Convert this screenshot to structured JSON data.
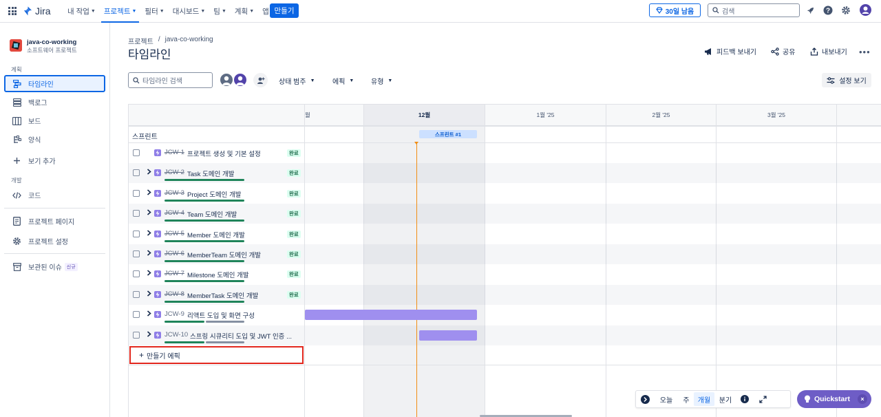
{
  "topnav": {
    "logo": "Jira",
    "items": [
      {
        "label": "내 작업",
        "active": false
      },
      {
        "label": "프로젝트",
        "active": true
      },
      {
        "label": "필터",
        "active": false
      },
      {
        "label": "대시보드",
        "active": false
      },
      {
        "label": "팀",
        "active": false
      },
      {
        "label": "계획",
        "active": false
      },
      {
        "label": "앱",
        "active": false
      }
    ],
    "create_label": "만들기",
    "trial_label": "30일 남음",
    "search_placeholder": "검색"
  },
  "sidebar": {
    "project_name": "java-co-working",
    "project_type": "소프트웨어 프로젝트",
    "section_planning": "계획",
    "section_dev": "개발",
    "items": {
      "timeline": "타임라인",
      "backlog": "백로그",
      "board": "보드",
      "forms": "양식",
      "add_view": "보기 추가",
      "code": "코드",
      "project_pages": "프로젝트 페이지",
      "project_settings": "프로젝트 설정",
      "archived": "보관된 이슈",
      "archived_badge": "신규"
    }
  },
  "header": {
    "breadcrumb_root": "프로젝트",
    "breadcrumb_sep": "/",
    "breadcrumb_project": "java-co-working",
    "title": "타임라인",
    "feedback": "피드백 보내기",
    "share": "공유",
    "export": "내보내기"
  },
  "toolbar": {
    "search_placeholder": "타임라인 검색",
    "status_category": "상태 범주",
    "epic": "에픽",
    "type": "유형",
    "view_settings": "설정 보기"
  },
  "timeline": {
    "months": [
      "월",
      "12월",
      "1월 '25",
      "2월 '25",
      "3월 '25"
    ],
    "sprints_label": "스프린트",
    "sprint_chip": "스프린트 #1",
    "done_label": "완료",
    "create_epic": "만들기 에픽",
    "issues": [
      {
        "key": "JCW-1",
        "summary": "프로젝트 생성 및 기본 설정",
        "done": true,
        "has_children": false,
        "progress": [
          1.0,
          0
        ]
      },
      {
        "key": "JCW-2",
        "summary": "Task 도메인 개발",
        "done": true,
        "has_children": true,
        "progress": [
          1.0,
          0
        ]
      },
      {
        "key": "JCW-3",
        "summary": "Project 도메인 개발",
        "done": true,
        "has_children": true,
        "progress": [
          1.0,
          0
        ]
      },
      {
        "key": "JCW-4",
        "summary": "Team 도메인 개발",
        "done": true,
        "has_children": true,
        "progress": [
          1.0,
          0
        ]
      },
      {
        "key": "JCW-5",
        "summary": "Member 도메인 개발",
        "done": true,
        "has_children": true,
        "progress": [
          1.0,
          0
        ]
      },
      {
        "key": "JCW-6",
        "summary": "MemberTeam 도메인 개발",
        "done": true,
        "has_children": true,
        "progress": [
          1.0,
          0
        ]
      },
      {
        "key": "JCW-7",
        "summary": "Milestone 도메인 개발",
        "done": true,
        "has_children": true,
        "progress": [
          1.0,
          0
        ]
      },
      {
        "key": "JCW-8",
        "summary": "MemberTask 도메인 개발",
        "done": true,
        "has_children": true,
        "progress": [
          1.0,
          0
        ]
      },
      {
        "key": "JCW-9",
        "summary": "리액트 도입 및 화면 구성",
        "done": false,
        "has_children": true,
        "progress": [
          0.5,
          0.5
        ]
      },
      {
        "key": "JCW-10",
        "summary": "스프링 시큐리티 도입 및 JWT 인증 ...",
        "done": false,
        "has_children": true,
        "progress": [
          0.5,
          0.5
        ]
      }
    ]
  },
  "zoom": {
    "today": "오늘",
    "week": "주",
    "month": "개월",
    "quarter": "분기",
    "active": "개월"
  },
  "quickstart": {
    "label": "Quickstart"
  },
  "colors": {
    "brand": "#0c66e4",
    "done_bar": "#1f845a",
    "todo_bar": "#8590a2",
    "epic_bar": "#9f8fef",
    "today_line": "#f18d13",
    "highlight_border": "#e2271d"
  }
}
